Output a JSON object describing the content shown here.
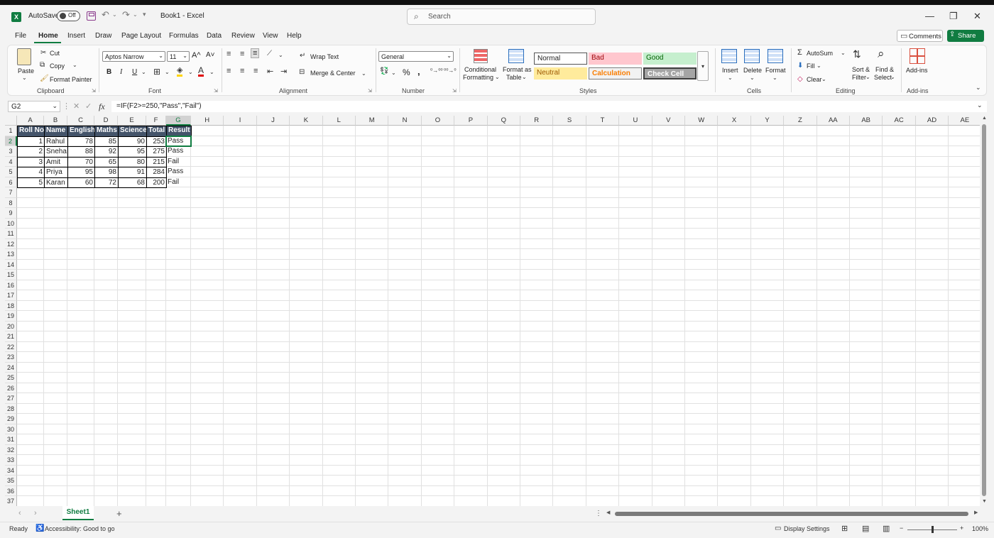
{
  "titlebar": {
    "autosave_label": "AutoSave",
    "autosave_state": "Off",
    "doc_title": "Book1  -  Excel",
    "search_placeholder": "Search"
  },
  "menu": {
    "items": [
      "File",
      "Home",
      "Insert",
      "Draw",
      "Page Layout",
      "Formulas",
      "Data",
      "Review",
      "View",
      "Help"
    ],
    "comments": "Comments",
    "share": "Share"
  },
  "ribbon": {
    "clipboard": {
      "label": "Clipboard",
      "paste": "Paste",
      "cut": "Cut",
      "copy": "Copy",
      "format_painter": "Format Painter"
    },
    "font": {
      "label": "Font",
      "font_name": "Aptos Narrow",
      "font_size": "11",
      "bold": "B",
      "italic": "I",
      "underline": "U",
      "grow": "A^",
      "shrink": "A˅"
    },
    "alignment": {
      "label": "Alignment",
      "wrap_text": "Wrap Text",
      "merge_center": "Merge & Center"
    },
    "number": {
      "label": "Number",
      "format": "General",
      "percent": "%",
      "comma": ","
    },
    "styles": {
      "label": "Styles",
      "conditional": "Conditional",
      "formatting": "Formatting",
      "format_as": "Format as",
      "table": "Table",
      "normal": "Normal",
      "bad": "Bad",
      "good": "Good",
      "neutral": "Neutral",
      "calculation": "Calculation",
      "check_cell": "Check Cell"
    },
    "cells": {
      "label": "Cells",
      "insert": "Insert",
      "delete": "Delete",
      "format": "Format"
    },
    "editing": {
      "label": "Editing",
      "autosum": "AutoSum",
      "fill": "Fill",
      "clear": "Clear",
      "sort": "Sort &",
      "filter": "Filter",
      "find": "Find &",
      "select": "Select"
    },
    "addins": {
      "label": "Add-ins",
      "addins": "Add-ins"
    }
  },
  "formula_bar": {
    "name_box": "G2",
    "formula": "=IF(F2>=250,\"Pass\",\"Fail\")"
  },
  "columns": [
    "A",
    "B",
    "C",
    "D",
    "E",
    "F",
    "G",
    "H",
    "I",
    "J",
    "K",
    "L",
    "M",
    "N",
    "O",
    "P",
    "Q",
    "R",
    "S",
    "T",
    "U",
    "V",
    "W",
    "X",
    "Y",
    "Z",
    "AA",
    "AB",
    "AC",
    "AD",
    "AE"
  ],
  "row_count": 37,
  "table": {
    "headers": [
      "Roll No",
      "Name",
      "English",
      "Maths",
      "Science",
      "Total",
      "Result"
    ],
    "rows": [
      [
        "1",
        "Rahul",
        "78",
        "85",
        "90",
        "253",
        "Pass"
      ],
      [
        "2",
        "Sneha",
        "88",
        "92",
        "95",
        "275",
        "Pass"
      ],
      [
        "3",
        "Amit",
        "70",
        "65",
        "80",
        "215",
        "Fail"
      ],
      [
        "4",
        "Priya",
        "95",
        "98",
        "91",
        "284",
        "Pass"
      ],
      [
        "5",
        "Karan",
        "60",
        "72",
        "68",
        "200",
        "Fail"
      ]
    ]
  },
  "selected_cell": "G2",
  "sheets": [
    "Sheet1"
  ],
  "status": {
    "ready": "Ready",
    "accessibility": "Accessibility: Good to go",
    "display_settings": "Display Settings",
    "zoom": "100%"
  },
  "colors": {
    "accent": "#107c41",
    "header_fill": "#44546a",
    "header_text": "#ffffff"
  }
}
